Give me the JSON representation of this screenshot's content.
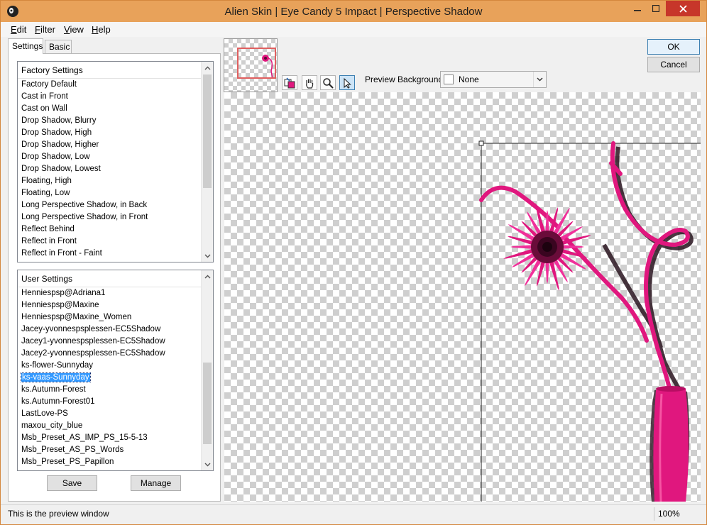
{
  "window": {
    "title": "Alien Skin | Eye Candy 5 Impact | Perspective Shadow"
  },
  "menu": [
    {
      "label": "Edit",
      "mnemonic": "E",
      "rest": "dit"
    },
    {
      "label": "Filter",
      "mnemonic": "F",
      "rest": "ilter"
    },
    {
      "label": "View",
      "mnemonic": "V",
      "rest": "iew"
    },
    {
      "label": "Help",
      "mnemonic": "H",
      "rest": "elp"
    }
  ],
  "tabs": {
    "settings": "Settings",
    "basic": "Basic"
  },
  "factory": {
    "header": "Factory Settings",
    "items": [
      "Factory Default",
      "Cast in Front",
      "Cast on Wall",
      "Drop Shadow, Blurry",
      "Drop Shadow, High",
      "Drop Shadow, Higher",
      "Drop Shadow, Low",
      "Drop Shadow, Lowest",
      "Floating, High",
      "Floating, Low",
      "Long Perspective Shadow, in Back",
      "Long Perspective Shadow, in Front",
      "Reflect Behind",
      "Reflect in Front",
      "Reflect in Front - Faint"
    ]
  },
  "user": {
    "header": "User Settings",
    "selected_index": 7,
    "items": [
      "Henniespsp@Adriana1",
      "Henniespsp@Maxine",
      "Henniespsp@Maxine_Women",
      "Jacey-yvonnespsplessen-EC5Shadow",
      "Jacey1-yvonnespsplessen-EC5Shadow",
      "Jacey2-yvonnespsplessen-EC5Shadow",
      "ks-flower-Sunnyday",
      "ks-vaas-Sunnyday",
      "ks.Autumn-Forest",
      "ks.Autumn-Forest01",
      "LastLove-PS",
      "maxou_city_blue",
      "Msb_Preset_AS_IMP_PS_15-5-13",
      "Msb_Preset_AS_PS_Words",
      "Msb_Preset_PS_Papillon"
    ]
  },
  "buttons": {
    "save": "Save",
    "manage": "Manage",
    "ok": "OK",
    "cancel": "Cancel"
  },
  "preview": {
    "background_label": "Preview Background:",
    "background_value": "None"
  },
  "status": {
    "text": "This is the preview window",
    "zoom": "100%"
  },
  "colors": {
    "titlebar": "#e8a25a",
    "close": "#c7362a",
    "selection": "#3399ff",
    "flower": "#e0177e"
  }
}
